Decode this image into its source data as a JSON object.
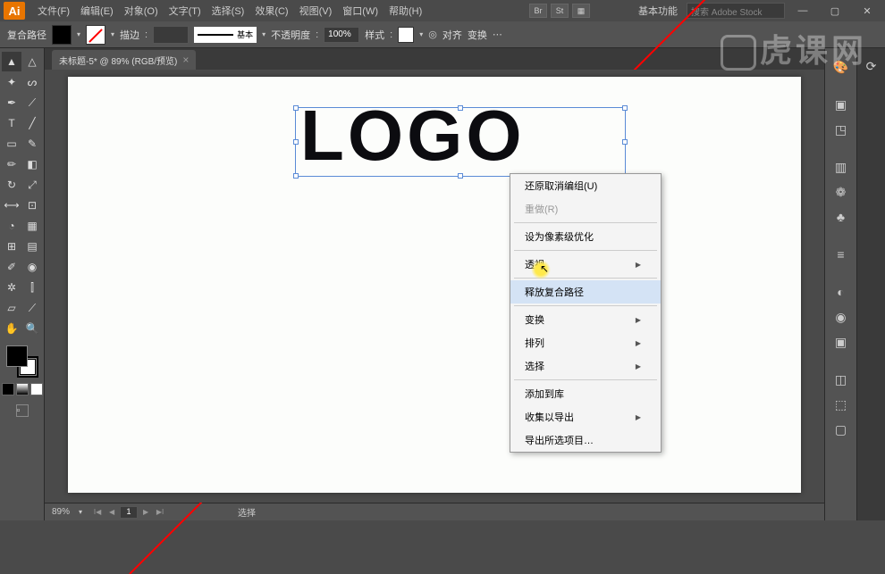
{
  "app": {
    "id": "Ai"
  },
  "menubar": [
    "文件(F)",
    "编辑(E)",
    "对象(O)",
    "文字(T)",
    "选择(S)",
    "效果(C)",
    "视图(V)",
    "窗口(W)",
    "帮助(H)"
  ],
  "titlebar": {
    "workspace": "基本功能",
    "search_placeholder": "搜索 Adobe Stock"
  },
  "controlbar": {
    "object_label": "复合路径",
    "stroke_label": "描边",
    "stroke_value": "",
    "stroke_style": "基本",
    "opacity_label": "不透明度",
    "opacity_value": "100%",
    "style_label": "样式",
    "align_label": "对齐",
    "transform_label": "变换"
  },
  "document": {
    "tab_title": "未标题-5* @ 89% (RGB/预览)",
    "logo_text": "LOGO"
  },
  "context_menu": {
    "undo": "还原取消编组(U)",
    "redo": "重做(R)",
    "pixel_opt": "设为像素级优化",
    "perspective": "透视",
    "release_path": "释放复合路径",
    "transform": "变换",
    "arrange": "排列",
    "select": "选择",
    "add_lib": "添加到库",
    "collect_export": "收集以导出",
    "export_sel": "导出所选项目…"
  },
  "status": {
    "zoom": "89%",
    "page": "1",
    "tool": "选择"
  },
  "watermark": "虎课网"
}
